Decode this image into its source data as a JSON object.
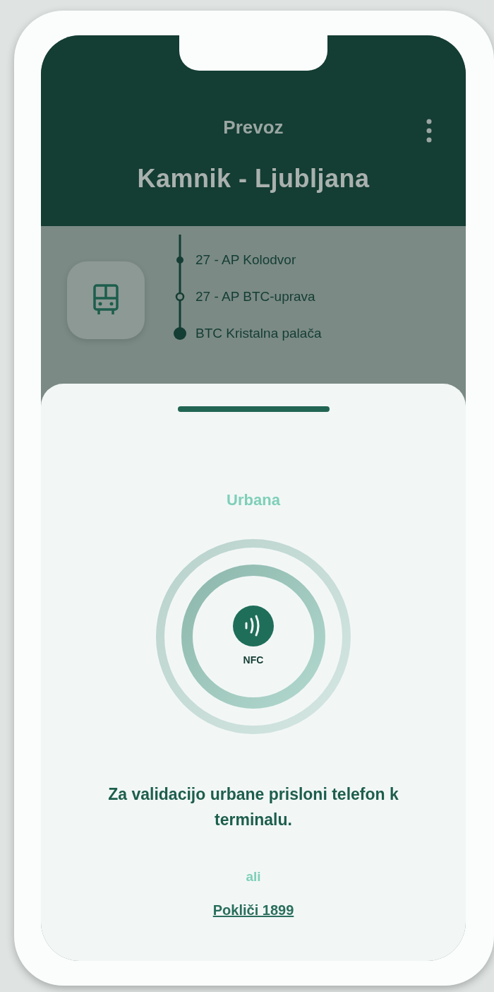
{
  "header": {
    "subtitle": "Prevoz",
    "title": "Kamnik - Ljubljana"
  },
  "route": {
    "stops": [
      {
        "name": "27 - AP Kolodvor",
        "kind": "stop"
      },
      {
        "name": "27 - AP BTC-uprava",
        "kind": "current"
      },
      {
        "name": "BTC Kristalna palača",
        "kind": "destination"
      }
    ]
  },
  "sheet": {
    "ticket_type": "Urbana",
    "nfc_label": "NFC",
    "instruction": "Za validacijo urbane prisloni telefon k terminalu.",
    "separator": "ali",
    "call_link": "Pokliči 1899"
  }
}
